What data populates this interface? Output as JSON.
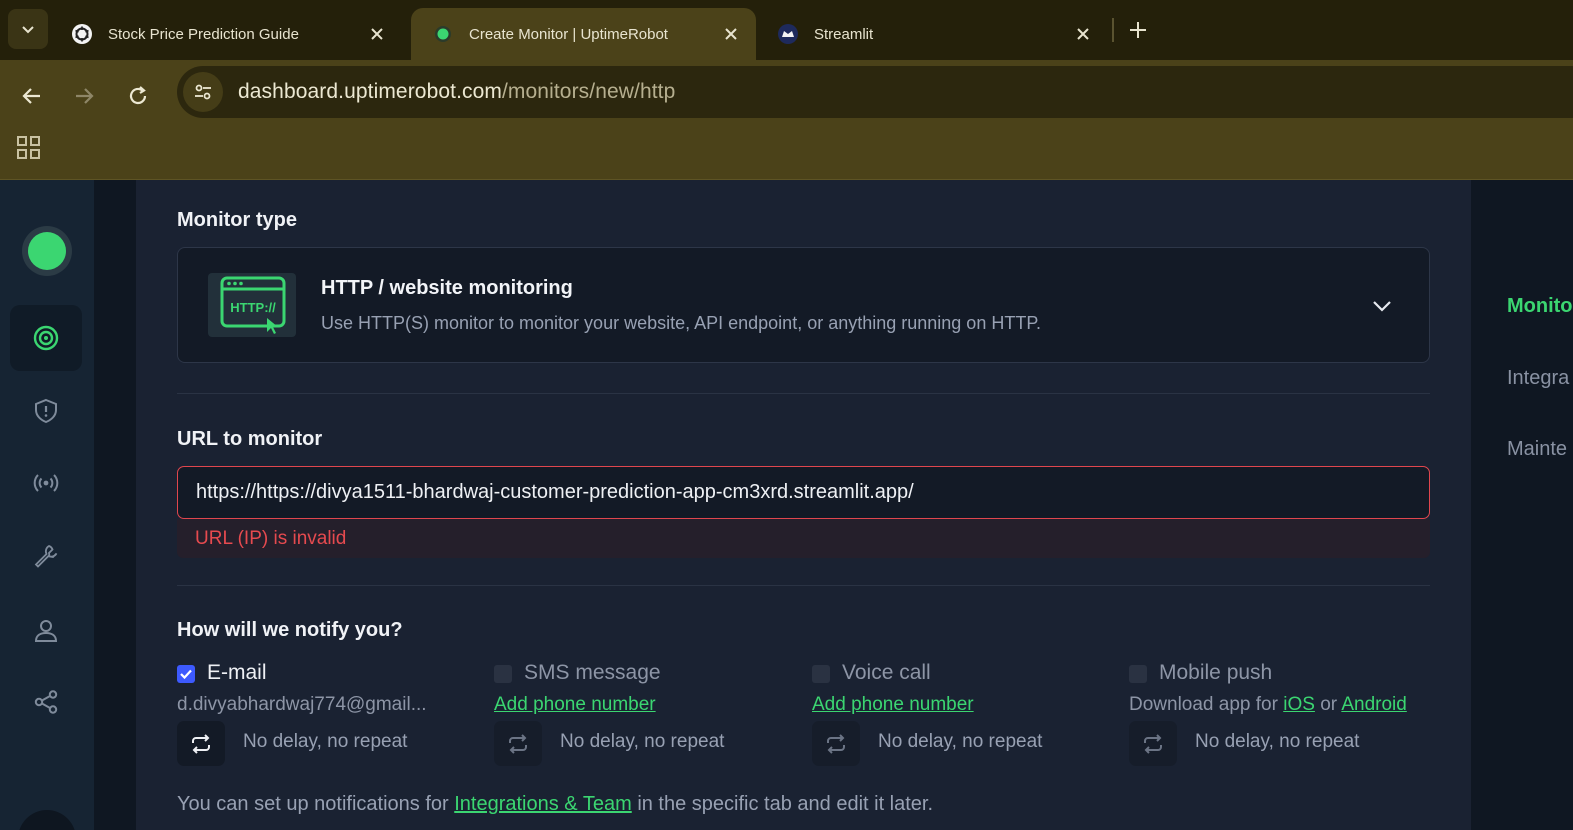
{
  "browser": {
    "tabs": [
      {
        "title": "Stock Price Prediction Guide",
        "icon": "openai-icon",
        "active": false
      },
      {
        "title": "Create Monitor | UptimeRobot",
        "icon": "uptimerobot-icon",
        "active": true
      },
      {
        "title": "Streamlit",
        "icon": "streamlit-icon",
        "active": false
      }
    ],
    "url_host": "dashboard.uptimerobot.com",
    "url_path": "/monitors/new/http"
  },
  "sidebar": {
    "items": [
      "monitoring-icon",
      "incidents-shield-icon",
      "status-broadcast-icon",
      "maintenance-wrench-icon",
      "team-user-icon",
      "integrations-share-icon"
    ]
  },
  "right_nav": {
    "items": [
      "Monito",
      "Integra",
      "Mainte"
    ],
    "active_index": 0
  },
  "form": {
    "monitor_type_heading": "Monitor type",
    "monitor_type": {
      "icon_text": "HTTP://",
      "title": "HTTP / website monitoring",
      "description": "Use HTTP(S) monitor to monitor your website, API endpoint, or anything running on HTTP."
    },
    "url_heading": "URL to monitor",
    "url_value": "https://https://divya1511-bhardwaj-customer-prediction-app-cm3xrd.streamlit.app/",
    "url_error": "URL (IP) is invalid",
    "notify_heading": "How will we notify you?",
    "channels": [
      {
        "label": "E-mail",
        "checked": true,
        "detail": "d.divyabhardwaj774@gmail...",
        "repeat": "No delay, no repeat"
      },
      {
        "label": "SMS message",
        "checked": false,
        "detail_link": "Add phone number",
        "repeat": "No delay, no repeat"
      },
      {
        "label": "Voice call",
        "checked": false,
        "detail_link": "Add phone number",
        "repeat": "No delay, no repeat"
      },
      {
        "label": "Mobile push",
        "checked": false,
        "detail_prefix": "Download app for",
        "link_ios": "iOS",
        "detail_or": "or",
        "link_android": "Android",
        "repeat": "No delay, no repeat"
      }
    ],
    "footer": {
      "prefix": "You can set up notifications for",
      "link": "Integrations & Team",
      "suffix": "in the specific tab and edit it later."
    }
  },
  "colors": {
    "accent": "#3bd671",
    "error": "#e64a4f",
    "browser_chrome": "#4b4219",
    "page_bg": "#1a2232"
  }
}
